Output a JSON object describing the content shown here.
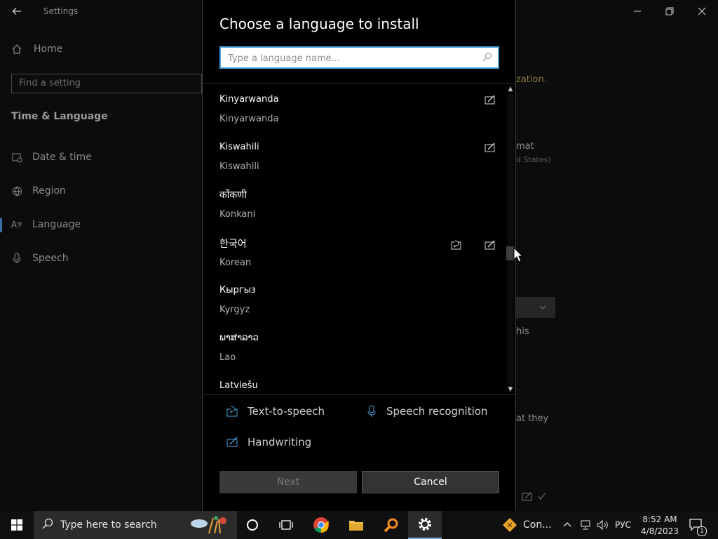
{
  "settings": {
    "app_title": "Settings",
    "home_label": "Home",
    "find_placeholder": "Find a setting",
    "section_title": "Time & Language",
    "nav": [
      {
        "label": "Date & time",
        "icon": "calendar-clock-icon"
      },
      {
        "label": "Region",
        "icon": "globe-icon"
      },
      {
        "label": "Language",
        "icon": "language-icon"
      },
      {
        "label": "Speech",
        "icon": "microphone-icon"
      }
    ],
    "bg_fragments": {
      "frag1": "zation.",
      "frag2": "mat",
      "frag3": "d States)",
      "frag4": "his",
      "frag5": "at they"
    }
  },
  "dialog": {
    "title": "Choose a language to install",
    "search_placeholder": "Type a language name...",
    "languages": [
      {
        "native": "Kinyarwanda",
        "english": "Kinyarwanda",
        "features": [
          "handwriting"
        ]
      },
      {
        "native": "Kiswahili",
        "english": "Kiswahili",
        "features": [
          "handwriting"
        ]
      },
      {
        "native": "कोंकणी",
        "english": "Konkani",
        "features": []
      },
      {
        "native": "한국어",
        "english": "Korean",
        "features": [
          "text-to-speech",
          "handwriting"
        ]
      },
      {
        "native": "Кыргыз",
        "english": "Kyrgyz",
        "features": []
      },
      {
        "native": "ພາສາລາວ",
        "english": "Lao",
        "features": []
      },
      {
        "native": "Latviešu",
        "english": "",
        "features": []
      }
    ],
    "legend": {
      "tts": "Text-to-speech",
      "speech_recognition": "Speech recognition",
      "handwriting": "Handwriting"
    },
    "next_label": "Next",
    "cancel_label": "Cancel",
    "scroll_position": 0.55
  },
  "taskbar": {
    "search_text": "Type here to search",
    "notification_app_label": "Con...",
    "input_language": "РУС",
    "time": "8:52 AM",
    "date": "4/8/2023",
    "notification_count": "1"
  },
  "colors": {
    "accent": "#4aa3df",
    "dialog_bg": "#000000",
    "settings_bg": "#0c0c0c"
  }
}
